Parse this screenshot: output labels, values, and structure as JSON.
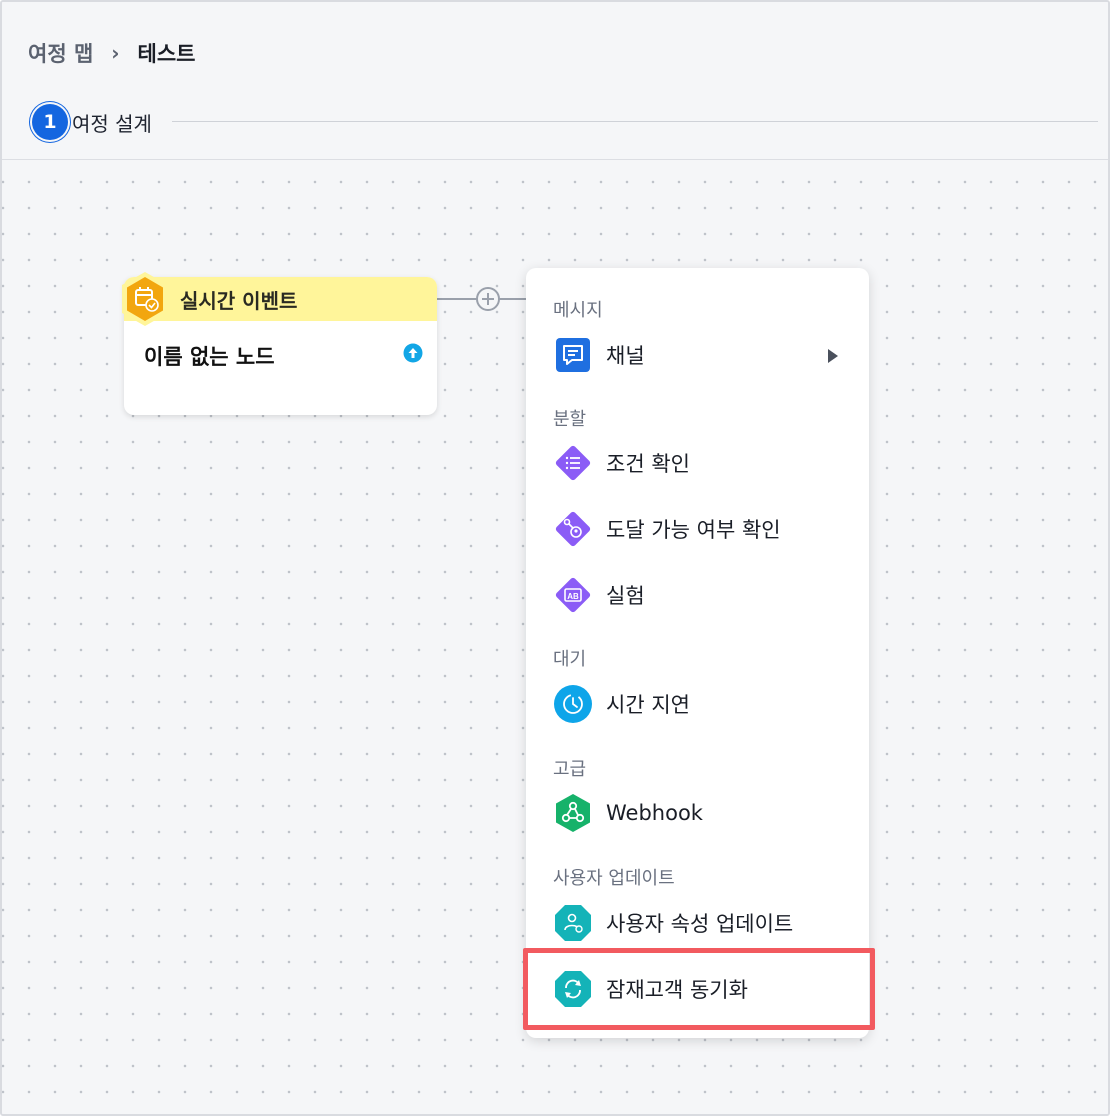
{
  "breadcrumb": {
    "parent": "여정 맵",
    "separator": "›",
    "current": "테스트"
  },
  "step": {
    "number": "1",
    "label": "여정 설계"
  },
  "node": {
    "type_label": "실시간 이벤트",
    "name": "이름 없는 노드",
    "icon": "calendar-check-icon",
    "header_color": "#fff59a"
  },
  "menu": {
    "sections": [
      {
        "title": "메시지",
        "items": [
          {
            "label": "채널",
            "icon": "chat-icon",
            "has_submenu": true
          }
        ]
      },
      {
        "title": "분할",
        "items": [
          {
            "label": "조건 확인",
            "icon": "list-icon"
          },
          {
            "label": "도달 가능 여부 확인",
            "icon": "reachability-icon"
          },
          {
            "label": "실험",
            "icon": "ab-test-icon"
          }
        ]
      },
      {
        "title": "대기",
        "items": [
          {
            "label": "시간 지연",
            "icon": "clock-icon"
          }
        ]
      },
      {
        "title": "고급",
        "items": [
          {
            "label": "Webhook",
            "icon": "webhook-icon"
          }
        ]
      },
      {
        "title": "사용자 업데이트",
        "items": [
          {
            "label": "사용자 속성 업데이트",
            "icon": "user-update-icon"
          },
          {
            "label": "잠재고객 동기화",
            "icon": "sync-icon",
            "highlighted": true
          }
        ]
      }
    ]
  },
  "colors": {
    "accent_blue": "#1466e0",
    "purple": "#8b5cf6",
    "teal": "#14b3b8",
    "green": "#16b26a",
    "highlight_red": "#f25a5f"
  }
}
